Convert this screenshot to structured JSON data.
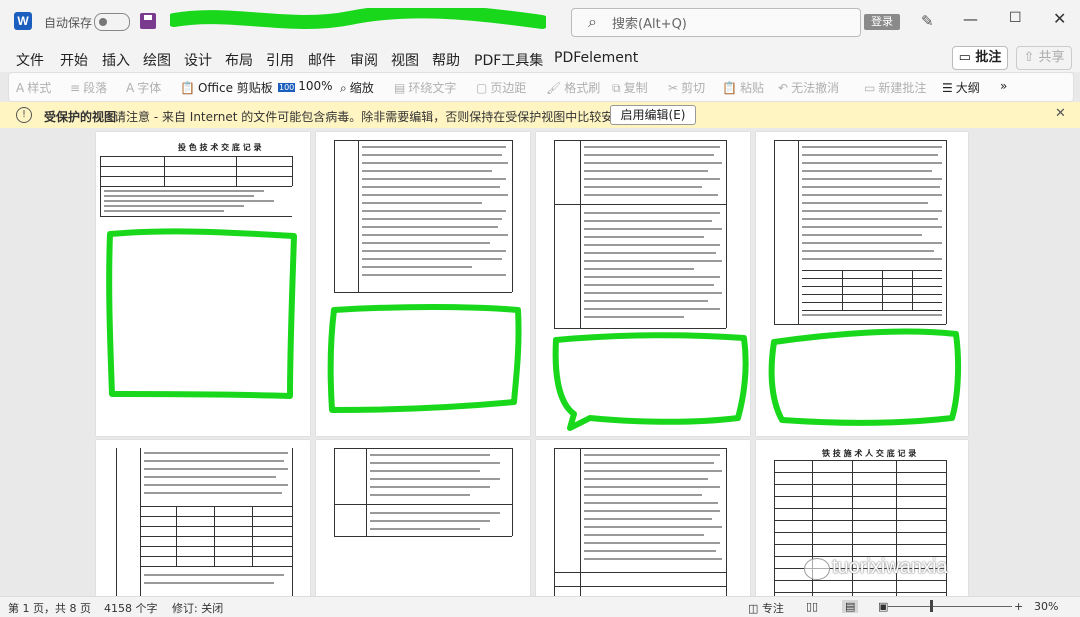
{
  "titlebar": {
    "app_icon": "word-logo-icon",
    "app_letter": "W",
    "autosave_label": "自动保存",
    "autosave_state": "off",
    "search_placeholder": "搜索(Alt+Q)",
    "login_label": "登录"
  },
  "menu": {
    "items": [
      "文件",
      "开始",
      "插入",
      "绘图",
      "设计",
      "布局",
      "引用",
      "邮件",
      "审阅",
      "视图",
      "帮助",
      "PDF工具集",
      "PDFelement"
    ],
    "annotate_label": "批注",
    "share_label": "共享"
  },
  "toolbar": {
    "items": [
      {
        "icon": "styles-icon",
        "label": "样式",
        "enabled": false
      },
      {
        "icon": "paragraph-icon",
        "label": "段落",
        "enabled": false
      },
      {
        "icon": "font-icon",
        "label": "字体",
        "enabled": false
      },
      {
        "icon": "clipboard-icon",
        "label": "Office 剪贴板",
        "enabled": true
      },
      {
        "icon": "zoom100-icon",
        "label": "100%",
        "enabled": true
      },
      {
        "icon": "zoom-icon",
        "label": "缩放",
        "enabled": true
      },
      {
        "icon": "wrap-text-icon",
        "label": "环绕文字",
        "enabled": false
      },
      {
        "icon": "margins-icon",
        "label": "页边距",
        "enabled": false
      },
      {
        "icon": "format-painter-icon",
        "label": "格式刷",
        "enabled": false
      },
      {
        "icon": "copy-icon",
        "label": "复制",
        "enabled": false
      },
      {
        "icon": "cut-icon",
        "label": "剪切",
        "enabled": false
      },
      {
        "icon": "paste-icon",
        "label": "粘贴",
        "enabled": false
      },
      {
        "icon": "undo-icon",
        "label": "无法撤消",
        "enabled": false
      },
      {
        "icon": "new-comment-icon",
        "label": "新建批注",
        "enabled": false
      },
      {
        "icon": "outline-icon",
        "label": "大纲",
        "enabled": true
      }
    ],
    "more_label": "»"
  },
  "protected_bar": {
    "title": "受保护的视图",
    "message": "请注意 - 来自 Internet 的文件可能包含病毒。除非需要编辑，否则保持在受保护视图中比较安全。",
    "enable_button": "启用编辑(E)"
  },
  "pages": {
    "page1_title": "投 色 技 术 交 底 记 录",
    "page8_title": "铁 技 施 术 人 交 底 记 录"
  },
  "status": {
    "page": "第 1 页，共 8 页",
    "words": "4158 个字",
    "track": "修订: 关闭",
    "focus": "专注",
    "zoom": "30%",
    "zoom_level": 0.3
  },
  "watermark": {
    "text": "tuorixiwanxia"
  },
  "colors": {
    "word_blue": "#1b5ebe",
    "highlighter_green": "#19d81c",
    "protected_bar": "#fff5c2"
  }
}
